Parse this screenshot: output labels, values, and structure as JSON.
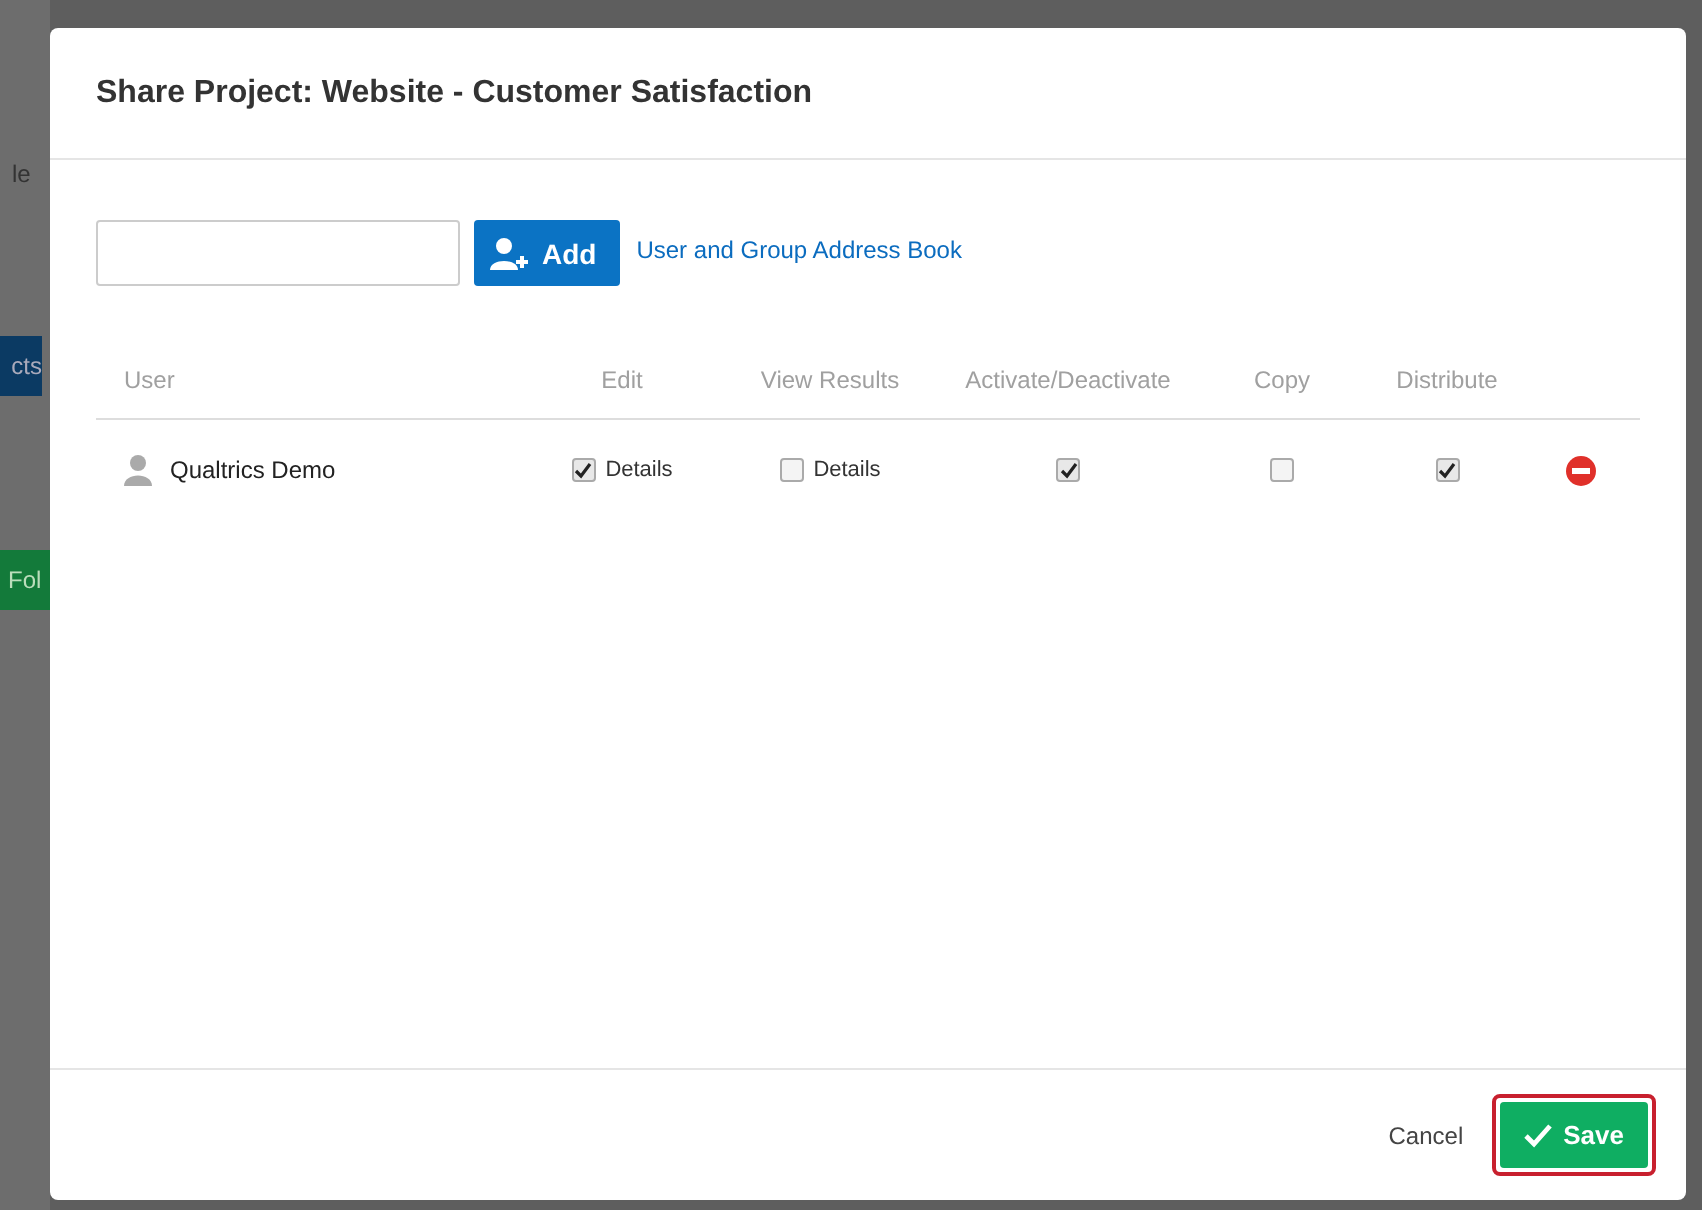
{
  "background": {
    "fragments": [
      "le",
      "cts",
      "Fol"
    ]
  },
  "dialog": {
    "title": "Share Project: Website - Customer Satisfaction"
  },
  "add_button": {
    "label": "Add"
  },
  "address_book_link": "User and Group Address Book",
  "table": {
    "columns": [
      "User",
      "Edit",
      "View Results",
      "Activate/Deactivate",
      "Copy",
      "Distribute"
    ],
    "rows": [
      {
        "user": "Qualtrics Demo",
        "edit": {
          "checked": true,
          "label": "Details"
        },
        "view_results": {
          "checked": false,
          "label": "Details"
        },
        "activate": {
          "checked": true
        },
        "copy": {
          "checked": false
        },
        "distribute": {
          "checked": true
        }
      }
    ]
  },
  "footer": {
    "cancel": "Cancel",
    "save": "Save",
    "save_highlighted": true
  }
}
